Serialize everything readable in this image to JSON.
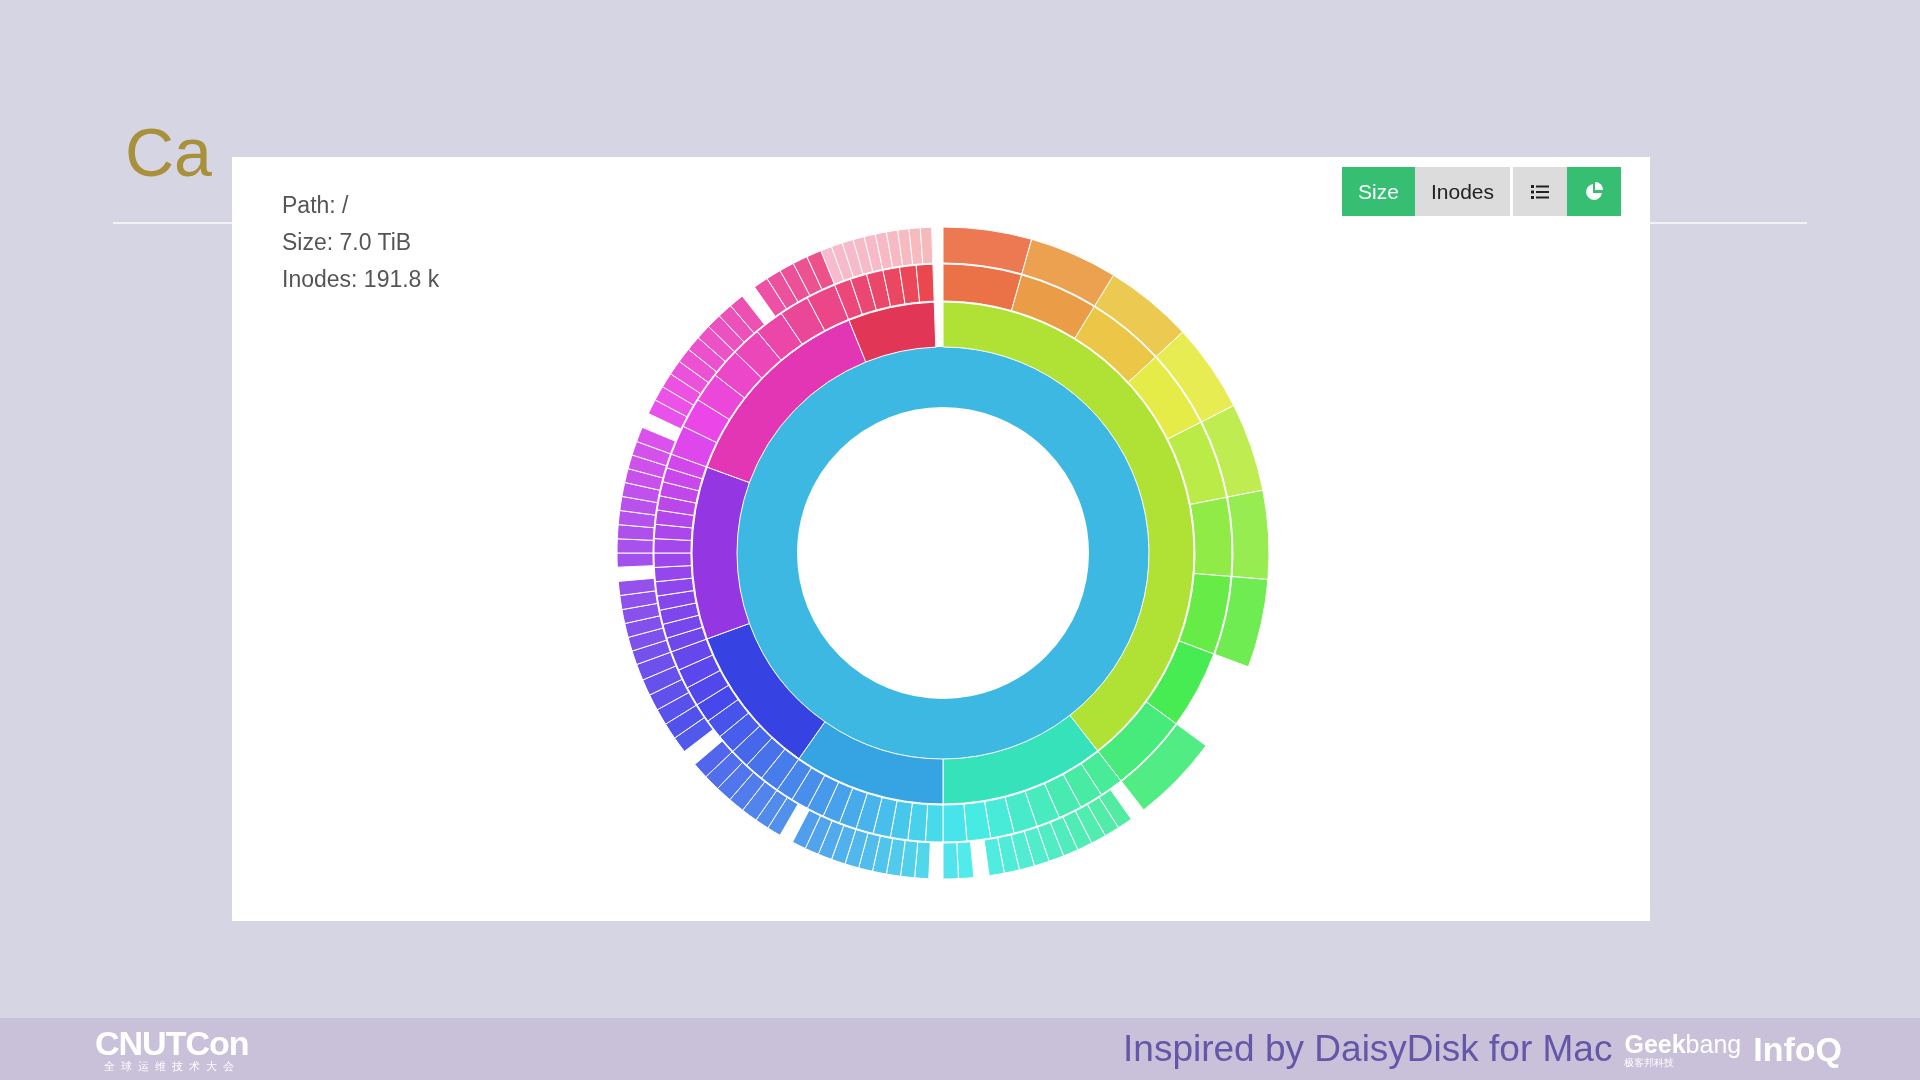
{
  "slide_title": "Ca",
  "info": [
    "Path: /",
    "Size: 7.0 TiB",
    "Inodes: 191.8 k"
  ],
  "buttons": [
    {
      "kind": "text",
      "label": "Size",
      "selected": true
    },
    {
      "kind": "text",
      "label": "Inodes",
      "selected": false
    },
    {
      "kind": "list",
      "selected": false
    },
    {
      "kind": "pie",
      "selected": true
    }
  ],
  "footer": {
    "caption": "Inspired by DaisyDisk for Mac",
    "logo_main": "CNUTCon",
    "logo_sub": "全球运维技术大会",
    "geek_a": "Geek",
    "geek_b": "bang",
    "geek_sub": "极客邦科技",
    "infoq": "InfoQ"
  }
}
